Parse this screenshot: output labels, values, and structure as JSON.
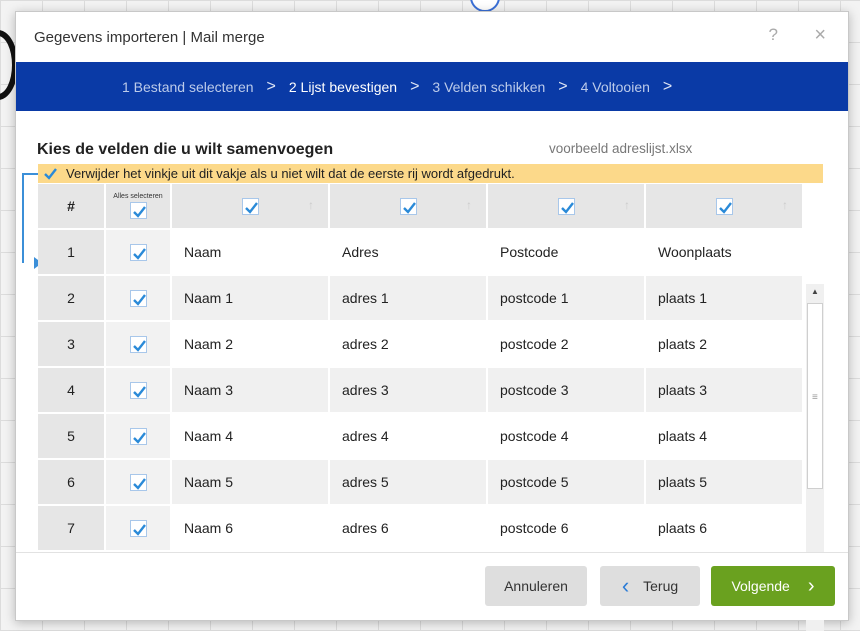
{
  "dialog": {
    "title": "Gegevens importeren | Mail merge",
    "help_label": "?",
    "close_label": "×"
  },
  "steps": [
    {
      "label": "1 Bestand selecteren"
    },
    {
      "label": "2 Lijst bevestigen"
    },
    {
      "label": "3 Velden schikken"
    },
    {
      "label": "4 Voltooien"
    }
  ],
  "step_separator": ">",
  "main": {
    "heading": "Kies de velden die u wilt samenvoegen",
    "filename": "voorbeeld adreslijst.xlsx",
    "notice": "Verwijder het vinkje uit dit vakje als u niet wilt dat de eerste rij wordt afgedrukt."
  },
  "table": {
    "num_header": "#",
    "select_all_label": "Alles selecteren",
    "sort_glyph": "↑",
    "rows": [
      {
        "num": "1",
        "cells": [
          "Naam",
          "Adres",
          "Postcode",
          "Woonplaats"
        ]
      },
      {
        "num": "2",
        "cells": [
          "Naam 1",
          "adres 1",
          "postcode 1",
          "plaats 1"
        ]
      },
      {
        "num": "3",
        "cells": [
          "Naam 2",
          "adres 2",
          "postcode 2",
          "plaats 2"
        ]
      },
      {
        "num": "4",
        "cells": [
          "Naam 3",
          "adres 3",
          "postcode 3",
          "plaats 3"
        ]
      },
      {
        "num": "5",
        "cells": [
          "Naam 4",
          "adres 4",
          "postcode 4",
          "plaats 4"
        ]
      },
      {
        "num": "6",
        "cells": [
          "Naam 5",
          "adres 5",
          "postcode 5",
          "plaats 5"
        ]
      },
      {
        "num": "7",
        "cells": [
          "Naam 6",
          "adres 6",
          "postcode 6",
          "plaats 6"
        ]
      }
    ]
  },
  "footer": {
    "cancel_label": "Annuleren",
    "back_label": "Terug",
    "next_label": "Volgende"
  },
  "colors": {
    "accent": "#0a3aa6",
    "primary_button": "#6aa11f",
    "notice_bg": "#fcd98a",
    "checkmark": "#2a8ad8"
  },
  "icons": {
    "checkbox": "check-icon",
    "back": "chevron-left-icon",
    "next": "chevron-right-icon"
  }
}
